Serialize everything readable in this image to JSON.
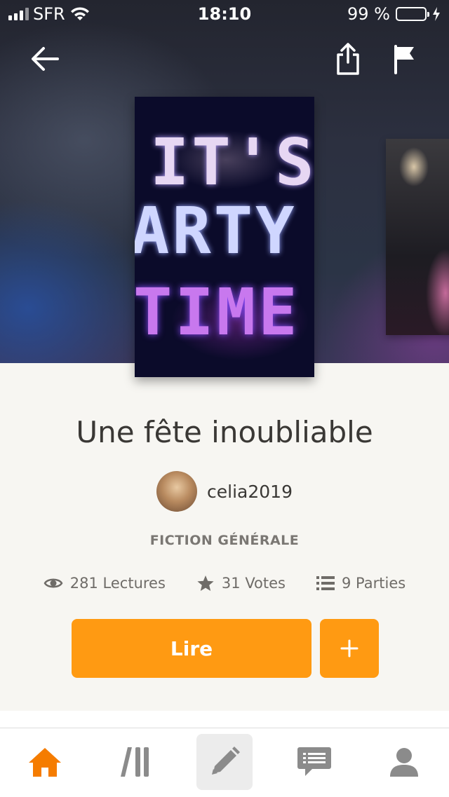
{
  "status_bar": {
    "carrier": "SFR",
    "time": "18:10",
    "battery_percent": "99 %"
  },
  "header": {
    "icons": [
      "back-arrow-icon",
      "share-icon",
      "flag-icon"
    ]
  },
  "cover": {
    "lines": [
      "IT'S",
      "ARTY",
      "TIME"
    ]
  },
  "story": {
    "title": "Une fête inoubliable",
    "author": "celia2019",
    "genre": "FICTION GÉNÉRALE",
    "reads": "281 Lectures",
    "votes": "31 Votes",
    "parts": "9 Parties"
  },
  "actions": {
    "read_label": "Lire",
    "add_label": "+"
  },
  "tabbar": {
    "items": [
      "home-icon",
      "library-icon",
      "write-icon",
      "messages-icon",
      "profile-icon"
    ]
  },
  "colors": {
    "accent": "#ff9a12",
    "active_tab": "#f57c00",
    "inactive_tab": "#8b8b8b"
  }
}
